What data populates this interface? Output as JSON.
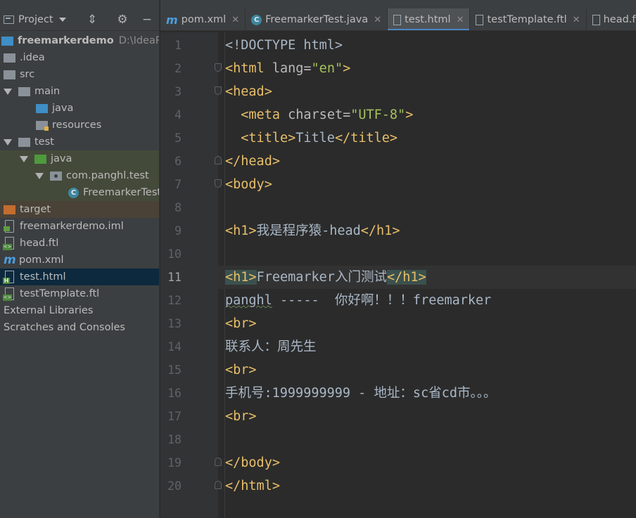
{
  "project_panel": {
    "title": "Project",
    "tree": [
      {
        "label": "freemarkerdemo",
        "path": "D:\\IdeaProject"
      },
      {
        "label": ".idea"
      },
      {
        "label": "src"
      },
      {
        "label": "main"
      },
      {
        "label": "java"
      },
      {
        "label": "resources"
      },
      {
        "label": "test"
      },
      {
        "label": "java"
      },
      {
        "label": "com.panghl.test"
      },
      {
        "label": "FreemarkerTest"
      },
      {
        "label": "target"
      },
      {
        "label": "freemarkerdemo.iml"
      },
      {
        "label": "head.ftl"
      },
      {
        "label": "pom.xml"
      },
      {
        "label": "test.html"
      },
      {
        "label": "testTemplate.ftl"
      },
      {
        "label": "External Libraries"
      },
      {
        "label": "Scratches and Consoles"
      }
    ]
  },
  "tabs": [
    {
      "label": "pom.xml",
      "icon": "maven-icon"
    },
    {
      "label": "FreemarkerTest.java",
      "icon": "class-icon"
    },
    {
      "label": "test.html",
      "icon": "html-file-icon",
      "active": true
    },
    {
      "label": "testTemplate.ftl",
      "icon": "ftl-file-icon"
    },
    {
      "label": "head.ftl",
      "icon": "ftl-file-icon"
    }
  ],
  "editor": {
    "current_line": 11,
    "lines": [
      {
        "n": "1",
        "t": "<!DOCTYPE html>"
      },
      {
        "n": "2",
        "t": "<html lang=\"en\">"
      },
      {
        "n": "3",
        "t": "<head>"
      },
      {
        "n": "4",
        "t": "  <meta charset=\"UTF-8\">"
      },
      {
        "n": "5",
        "t": "  <title>Title</title>"
      },
      {
        "n": "6",
        "t": "</head>"
      },
      {
        "n": "7",
        "t": "<body>"
      },
      {
        "n": "8",
        "t": ""
      },
      {
        "n": "9",
        "t": "<h1>我是程序猿-head</h1>"
      },
      {
        "n": "10",
        "t": ""
      },
      {
        "n": "11",
        "t": "<h1>Freemarker入门测试</h1>"
      },
      {
        "n": "12",
        "t": "panghl -----  你好啊！！！freemarker"
      },
      {
        "n": "13",
        "t": "<br>"
      },
      {
        "n": "14",
        "t": "联系人：周先生"
      },
      {
        "n": "15",
        "t": "<br>"
      },
      {
        "n": "16",
        "t": "手机号:1999999999 - 地址：sc省cd市。。。"
      },
      {
        "n": "17",
        "t": "<br>"
      },
      {
        "n": "18",
        "t": ""
      },
      {
        "n": "19",
        "t": "</body>"
      },
      {
        "n": "20",
        "t": "</html>"
      }
    ]
  },
  "colors": {
    "background": "#2b2b2b",
    "panel": "#3c3f41",
    "tag": "#e8bf6a",
    "attr_value": "#a5c25c",
    "text": "#a9b7c6",
    "selection": "#0d293e",
    "active_tab_underline": "#4a88c7"
  }
}
